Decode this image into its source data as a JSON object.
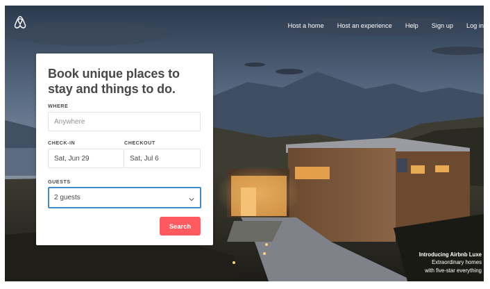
{
  "nav": {
    "host_home": "Host a home",
    "host_experience": "Host an experience",
    "help": "Help",
    "signup": "Sign up",
    "login": "Log in"
  },
  "search_card": {
    "title": "Book unique places to stay and things to do.",
    "where_label": "WHERE",
    "where_placeholder": "Anywhere",
    "checkin_label": "CHECK-IN",
    "checkin_value": "Sat, Jun 29",
    "checkout_label": "CHECKOUT",
    "checkout_value": "Sat, Jul 6",
    "guests_label": "GUESTS",
    "guests_value": "2 guests",
    "search_button": "Search"
  },
  "promo": {
    "title": "Introducing Airbnb Luxe",
    "line1": "Extraordinary homes",
    "line2": "with five-star everything"
  },
  "colors": {
    "brand": "#ff5a5f",
    "focus_border": "#3d8bc9",
    "text": "#484848"
  },
  "icons": {
    "logo": "airbnb-logo-icon",
    "dropdown": "chevron-down-icon"
  }
}
